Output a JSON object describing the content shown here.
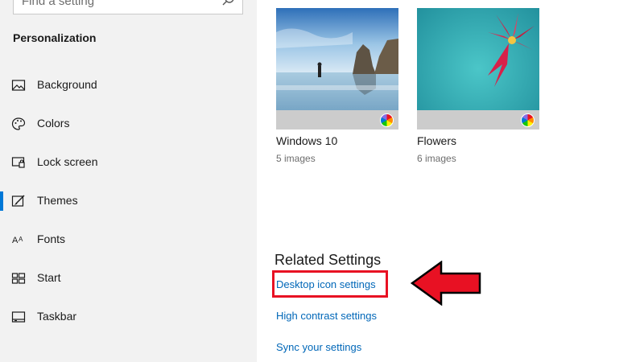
{
  "search": {
    "placeholder": "Find a setting"
  },
  "sidebar": {
    "section_title": "Personalization",
    "items": [
      {
        "label": "Background",
        "icon": "image-icon"
      },
      {
        "label": "Colors",
        "icon": "palette-icon"
      },
      {
        "label": "Lock screen",
        "icon": "lock-screen-icon"
      },
      {
        "label": "Themes",
        "icon": "brush-icon",
        "active": true
      },
      {
        "label": "Fonts",
        "icon": "fonts-icon"
      },
      {
        "label": "Start",
        "icon": "start-icon"
      },
      {
        "label": "Taskbar",
        "icon": "taskbar-icon"
      }
    ]
  },
  "themes": [
    {
      "name": "Windows 10",
      "count": "5 images"
    },
    {
      "name": "Flowers",
      "count": "6 images"
    }
  ],
  "related": {
    "title": "Related Settings",
    "links": [
      "Desktop icon settings",
      "High contrast settings",
      "Sync your settings"
    ]
  },
  "colors": {
    "accent": "#0078d7",
    "link": "#0067b8",
    "highlight": "#e81123"
  }
}
